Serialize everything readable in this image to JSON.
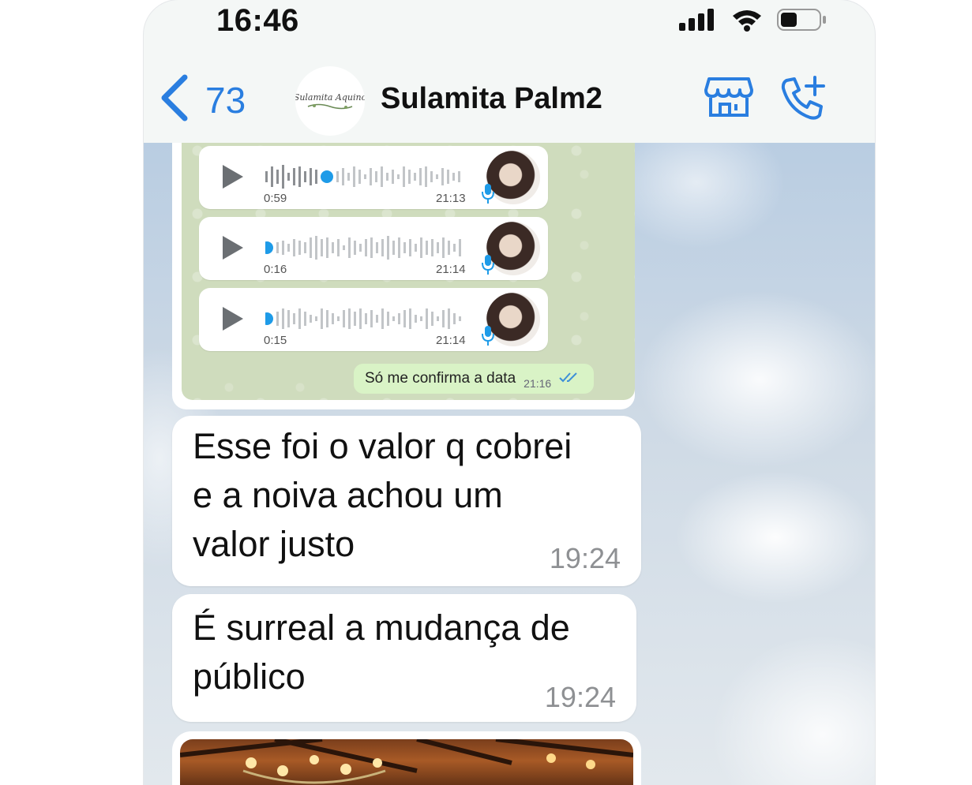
{
  "status_bar": {
    "time": "16:46",
    "icons": [
      "signal-icon",
      "wifi-icon",
      "battery-icon"
    ]
  },
  "header": {
    "back_count": "73",
    "avatar_logo_text": "Sulamita Aquino",
    "contact_name": "Sulamita Palm2",
    "actions": [
      "store-icon",
      "add-call-icon"
    ],
    "accent_color": "#2a7ee0"
  },
  "image_message": {
    "voice_messages": [
      {
        "duration": "0:59",
        "time": "21:13",
        "progress": 0.3
      },
      {
        "duration": "0:16",
        "time": "21:14",
        "progress": 0.0
      },
      {
        "duration": "0:15",
        "time": "21:14",
        "progress": 0.0
      }
    ],
    "sent_text": "Só me confirma a data",
    "sent_time": "21:16"
  },
  "messages": [
    {
      "lines": [
        "Esse foi o valor q cobrei",
        "e a noiva achou um",
        "valor justo"
      ],
      "time": "19:24"
    },
    {
      "lines": [
        "É surreal a mudança de",
        "público"
      ],
      "time": "19:24"
    }
  ]
}
